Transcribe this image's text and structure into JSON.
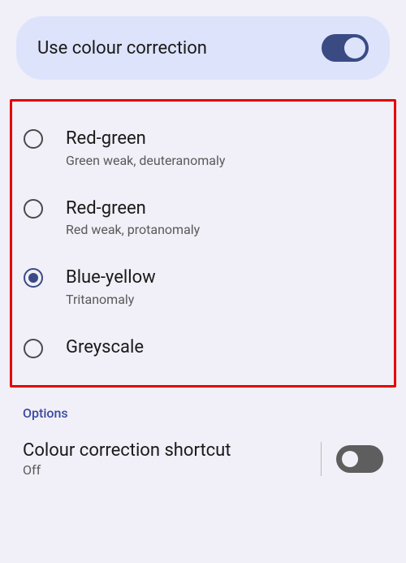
{
  "main_toggle": {
    "label": "Use colour correction",
    "enabled": true
  },
  "correction_modes": [
    {
      "title": "Red-green",
      "subtitle": "Green weak, deuteranomaly",
      "selected": false
    },
    {
      "title": "Red-green",
      "subtitle": "Red weak, protanomaly",
      "selected": false
    },
    {
      "title": "Blue-yellow",
      "subtitle": "Tritanomaly",
      "selected": true
    },
    {
      "title": "Greyscale",
      "subtitle": "",
      "selected": false
    }
  ],
  "options_header": "Options",
  "shortcut": {
    "title": "Colour correction shortcut",
    "status": "Off",
    "enabled": false
  }
}
